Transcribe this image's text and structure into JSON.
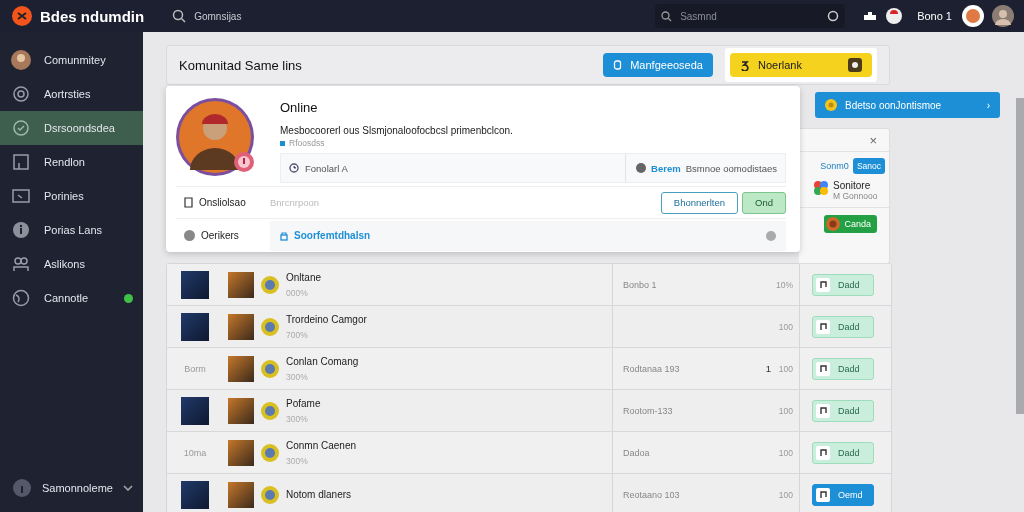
{
  "topbar": {
    "app_title": "Bdes ndumdin",
    "nav_text": "Gomnsijas",
    "search": {
      "placeholder": "Sasmnd"
    },
    "user_label": "Bono 1"
  },
  "sidebar": {
    "items": [
      {
        "label": "Comunmitey",
        "selected": false,
        "unread": false
      },
      {
        "label": "Aortrsties",
        "selected": false,
        "unread": false
      },
      {
        "label": "Dsrsoondsdea",
        "selected": true,
        "unread": false
      },
      {
        "label": "Rendlon",
        "selected": false,
        "unread": false
      },
      {
        "label": "Porinies",
        "selected": false,
        "unread": false
      },
      {
        "label": "Porias Lans",
        "selected": false,
        "unread": false
      },
      {
        "label": "Aslikons",
        "selected": false,
        "unread": false
      },
      {
        "label": "Cannotle",
        "selected": false,
        "unread": true
      }
    ],
    "footer": {
      "label": "Samonnoleme"
    }
  },
  "header": {
    "title": "Komunitad Same lins",
    "buttons": [
      {
        "label": "Manfgeeoseda",
        "kind": "primary"
      },
      {
        "label": "Noerlank",
        "kind": "warning"
      }
    ]
  },
  "banner": {
    "text": "Bdetso oonJontismoe",
    "arrow": "›"
  },
  "profile": {
    "name": "Online",
    "description": "Mesbocoorerl ous Slsmjonaloofocbcsl primenbclcon.",
    "status": "Rfoosdss",
    "info_left": "Fonolarl A",
    "info_link": "Berem",
    "info_right": "Bsmnoe oomodistaes",
    "field_label": "Onsliolsao",
    "field": {
      "placeholder": "Bnrcnrpoon"
    },
    "buttons": [
      {
        "label": "Bhonnerlten",
        "kind": "outline"
      },
      {
        "label": "Ond",
        "kind": "success"
      }
    ],
    "footer_label": "Oerikers",
    "footer_link": "Soorfemtdhalsn"
  },
  "side_panel": {
    "close": "×",
    "link": "Sonm0",
    "button": "Sanoc",
    "title": "Sonitore",
    "subtitle": "M Gonnooo",
    "footer_button": "Canda"
  },
  "table": {
    "rows": [
      {
        "kind": "image",
        "lead": "",
        "name": "Onltane",
        "sub": "000%",
        "column_3": "Bonbo 1",
        "column_4": "",
        "percent": "10%",
        "action": {
          "label": "Dadd",
          "selected": false
        }
      },
      {
        "kind": "image",
        "lead": "",
        "name": "Trordeino Camgor",
        "sub": "700%",
        "column_3": "",
        "column_4": "",
        "percent": "100",
        "action": {
          "label": "Dadd",
          "selected": false
        }
      },
      {
        "kind": "text",
        "lead": "Borm",
        "name": "Conlan Comang",
        "sub": "300%",
        "column_3": "Rodtanaa 193",
        "column_4": "1",
        "percent": "100",
        "action": {
          "label": "Dadd",
          "selected": false
        }
      },
      {
        "kind": "image",
        "lead": "",
        "name": "Pofame",
        "sub": "300%",
        "column_3": "Rootom-133",
        "column_4": "",
        "percent": "100",
        "action": {
          "label": "Dadd",
          "selected": false
        }
      },
      {
        "kind": "text",
        "lead": "10ma",
        "name": "Conmn Caenen",
        "sub": "300%",
        "column_3": "Dadoa",
        "column_4": "",
        "percent": "100",
        "action": {
          "label": "Dadd",
          "selected": false
        }
      },
      {
        "kind": "image",
        "lead": "",
        "name": "Notom dlaners",
        "sub": "",
        "column_3": "Reotaano 103",
        "column_4": "",
        "percent": "100",
        "action": {
          "label": "Oemd",
          "selected": true
        }
      }
    ]
  }
}
